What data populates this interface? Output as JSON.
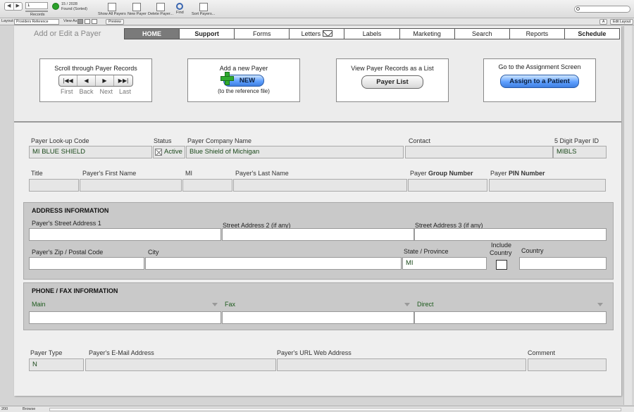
{
  "toolbar": {
    "record_value": "1",
    "records_label": "Records",
    "found_count": "15 / 2028",
    "found_label": "Found (Sorted)",
    "show_all": "Show All Payers",
    "new_payer": "New Payer",
    "delete_payer": "Delete Payer...",
    "find": "Find",
    "sort_payers": "Sort Payers...",
    "search_placeholder": ""
  },
  "layoutbar": {
    "layout_label": "Layout:",
    "layout_value": "Providers Reference",
    "view_as": "View As:",
    "preview": "Preview",
    "aa": "A",
    "edit_layout": "Edit Layout"
  },
  "header": {
    "title": "Add or Edit a Payer"
  },
  "tabs": [
    {
      "label": "HOME"
    },
    {
      "label": "Support"
    },
    {
      "label": "Forms"
    },
    {
      "label": "Letters"
    },
    {
      "label": "Labels"
    },
    {
      "label": "Marketing"
    },
    {
      "label": "Search"
    },
    {
      "label": "Reports"
    },
    {
      "label": "Schedule"
    }
  ],
  "actions": {
    "scroll_caption": "Scroll through Payer Records",
    "nav_first": "First",
    "nav_back": "Back",
    "nav_next": "Next",
    "nav_last": "Last",
    "new_caption": "Add a new Payer",
    "new_button": "NEW",
    "new_sub": "(to the reference file)",
    "list_caption": "View Payer Records as a List",
    "list_button": "Payer List",
    "assign_caption": "Go to the Assignment Screen",
    "assign_button": "Assign to a Patient"
  },
  "payer": {
    "lookup_label": "Payer Look-up Code",
    "lookup_value": "MI BLUE SHIELD",
    "status_label": "Status",
    "status_value": "Active",
    "company_label": "Payer Company Name",
    "company_value": "Blue Shield of Michigan",
    "contact_label": "Contact",
    "contact_value": "",
    "id_label": "5 Digit Payer ID",
    "id_value": "MIBLS",
    "title_label": "Title",
    "first_label": "Payer's First Name",
    "mi_label": "MI",
    "last_label": "Payer's  Last Name",
    "group_label_pre": "Payer ",
    "group_label_bold": "Group Number",
    "pin_label_pre": "Payer ",
    "pin_label_bold": "PIN Number"
  },
  "address": {
    "section_title": "ADDRESS INFORMATION",
    "street1_label": "Payer's Street Address 1",
    "street2_label": "Street Address 2 (if any)",
    "street3_label": "Street Address 3 (if any)",
    "zip_label": "Payer's Zip / Postal Code",
    "city_label": "City",
    "state_label": "State / Province",
    "state_value": "MI",
    "include_label_1": "Include",
    "include_label_2": "Country",
    "country_label": "Country"
  },
  "phone": {
    "section_title": "PHONE / FAX INFORMATION",
    "main_label": "Main",
    "fax_label": "Fax",
    "direct_label": "Direct"
  },
  "other": {
    "type_label": "Payer Type",
    "type_value": "N",
    "email_label": "Payer's E-Mail Address",
    "url_label": "Payer's URL Web Address",
    "comment_label": "Comment"
  },
  "status": {
    "zoom": "200",
    "mode": "Browse"
  }
}
